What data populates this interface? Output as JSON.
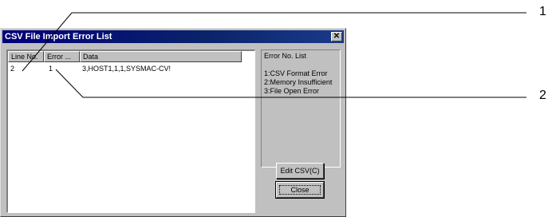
{
  "dialog": {
    "title": "CSV File Import Error List",
    "close_glyph": "✕"
  },
  "list": {
    "columns": [
      "Line No.",
      "Error ...",
      "Data"
    ],
    "rows": [
      {
        "line": "2",
        "error": "1",
        "data": "3,HOST1,1,1,SYSMAC-CV!"
      }
    ]
  },
  "error_list": {
    "title": "Error No. List",
    "items": [
      "1:CSV Format Error",
      "2:Memory Insufficient",
      "3:File Open Error"
    ]
  },
  "buttons": {
    "edit_csv": "Edit CSV(C)",
    "close": "Close"
  },
  "callouts": [
    "1",
    "2"
  ]
}
